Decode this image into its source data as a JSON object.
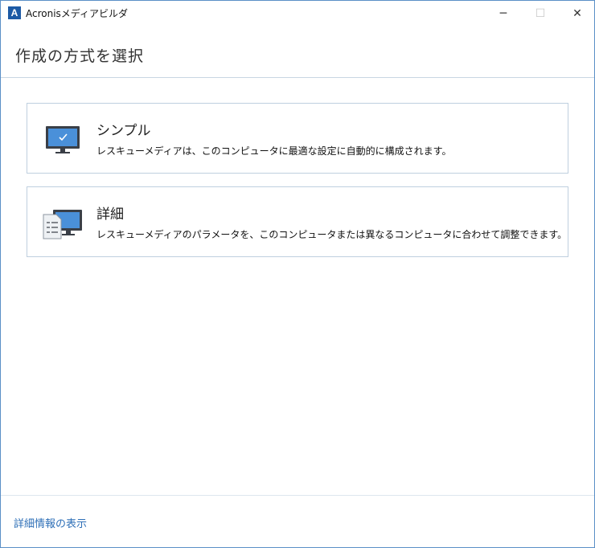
{
  "window": {
    "title": "Acronisメディアビルダ",
    "app_icon_letter": "A",
    "controls": {
      "minimize": "─",
      "maximize": "☐",
      "close": "✕"
    }
  },
  "header": {
    "title": "作成の方式を選択"
  },
  "options": [
    {
      "title": "シンプル",
      "description": "レスキューメディアは、このコンピュータに最適な設定に自動的に構成されます。",
      "icon": "monitor-check-icon"
    },
    {
      "title": "詳細",
      "description": "レスキューメディアのパラメータを、このコンピュータまたは異なるコンピュータに合わせて調整できます。",
      "icon": "document-monitor-icon"
    }
  ],
  "footer": {
    "link": "詳細情報の表示"
  },
  "colors": {
    "accent": "#2e6fb7",
    "border": "#bfcfdf",
    "monitor": "#4a90d9"
  }
}
